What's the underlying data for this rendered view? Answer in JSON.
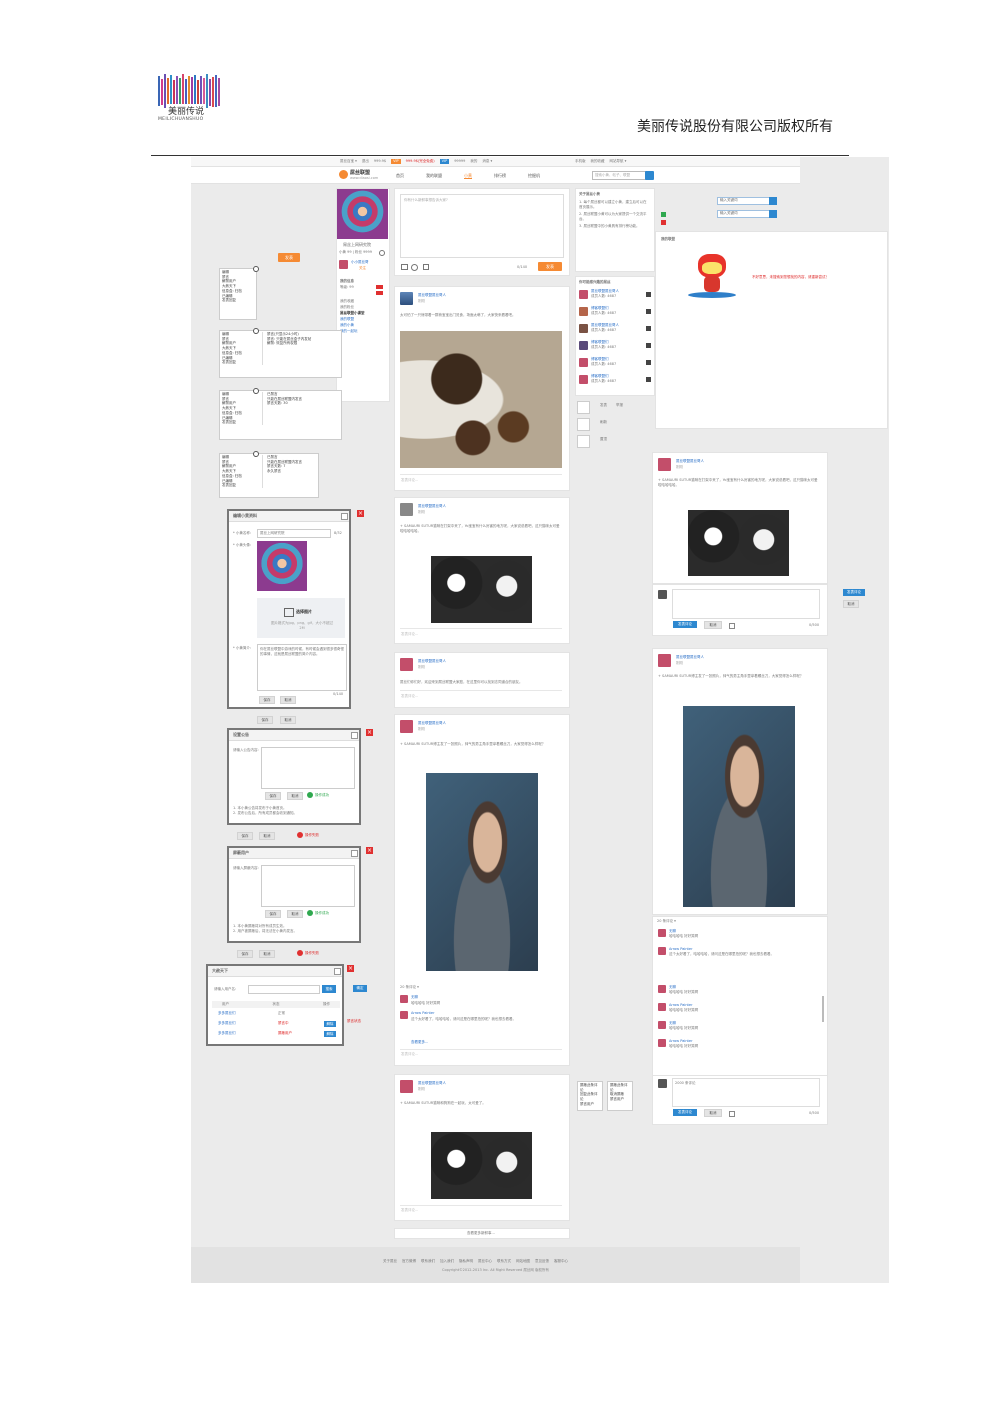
{
  "doc": {
    "logo_text": "美丽传说",
    "logo_sub": "MEILICHUANSHUO",
    "copyright_header": "美丽传说股份有限公司版权所有"
  },
  "topbar": {
    "items": [
      "屌丝百宝 ▾",
      "退出",
      "999.9$",
      "VIP",
      "999.9$(完全免费)",
      "VIP",
      "99999",
      "我的",
      "消息 ▾"
    ],
    "right": [
      "手机版",
      "我的收藏",
      "网站导航 ▾"
    ]
  },
  "nav": {
    "brand": "屌丝联盟",
    "brand_sub": "www.diaosi.com",
    "tabs": [
      "首页",
      "我的联盟",
      "小黄",
      "排行榜",
      "挖掘机"
    ],
    "search_placeholder": "搜索小黄、帖子、联盟",
    "search_icon": "search-icon"
  },
  "profile": {
    "name": "屌丝上网研究院",
    "stats": "小黄 99 | 粉丝 9999",
    "gear": "gear-icon",
    "user": "小小屌丝哥",
    "action": "关注",
    "publish": "发表",
    "level": "等级: 99",
    "menu_title": "我的信息",
    "menu_items": [
      "我的收藏",
      "我的粉丝",
      "屌丝联盟小课堂",
      "我的联盟",
      "我的小黄",
      "我的一起玩"
    ]
  },
  "popup_menus": [
    {
      "items": [
        "编辑",
        "禁言",
        "解禁用户",
        "大赦天下",
        "信息盒: 归档",
        "已编辑",
        "发表回复"
      ]
    },
    {
      "items": [
        "编辑",
        "禁言",
        "解禁用户",
        "大赦天下",
        "信息盒: 归档",
        "已编辑",
        "发表回复"
      ],
      "right_title": "禁言(只显示24小时)",
      "right_items": [
        "禁言: 只能在屌丝盒子内发帖",
        "解禁: 恢复所有权限"
      ]
    },
    {
      "items": [
        "编辑",
        "禁言",
        "解禁用户",
        "大赦天下",
        "信息盒: 归档",
        "已编辑",
        "发表回复"
      ],
      "right_title": "已禁言",
      "right_items": [
        "只能在屌丝联盟内发言",
        "禁言天数: 30"
      ]
    },
    {
      "items": [
        "编辑",
        "禁言",
        "解禁用户",
        "大赦天下",
        "信息盒: 归档",
        "已编辑",
        "发表回复"
      ],
      "right_title": "已禁言",
      "right_items": [
        "只能在屌丝联盟内发言",
        "禁言天数: 7",
        "永久禁言"
      ]
    }
  ],
  "dialogs": {
    "edit_profile": {
      "title": "编辑小黄资料",
      "name_label": "* 小黄名称:",
      "name_value": "屌丝上网研究院",
      "count": "8/32",
      "avatar_label": "* 小黄头像:",
      "upload_btn": "选择图片",
      "upload_hint": "图片格式为jpg、png、gif，大小不超过2M",
      "intro_label": "* 小黄简介:",
      "intro_text": "你在屌丝联盟中游戏的时候，有时候会遇到很多很奇怪的事情，这就是屌丝联盟的简介内容。",
      "intro_count": "0/140",
      "save": "保存",
      "cancel": "取消",
      "outer_save": "保存",
      "outer_cancel": "取消"
    },
    "announce": {
      "title": "设置公告",
      "label": "请输入公告内容:",
      "save": "保存",
      "cancel": "取消",
      "ok_text": "操作成功",
      "notes": [
        "1. 本小黄公告将发布于小黄首页。",
        "2. 发布公告后，所有成员都会收到通知。"
      ],
      "outer_save": "保存",
      "outer_cancel": "取消",
      "fail_text": "操作失败"
    },
    "ban": {
      "title": "屏蔽用户",
      "label": "请输入屏蔽内容:",
      "save": "保存",
      "cancel": "取消",
      "ok_text": "操作成功",
      "notes": [
        "1. 本小黄屏蔽将对所有成员生效。",
        "2. 用户被屏蔽后，将无法在小黄内发言。"
      ],
      "outer_save": "保存",
      "outer_cancel": "取消",
      "fail_text": "操作失败"
    },
    "amnesty": {
      "title": "大赦天下",
      "label": "请输入用户名:",
      "search": "搜索",
      "cols": [
        "用户",
        "状态",
        "操作"
      ],
      "rows": [
        {
          "user": "多多屌丝们",
          "status": "正常",
          "op": ""
        },
        {
          "user": "多多屌丝们",
          "status": "禁言中",
          "op": "解除"
        },
        {
          "user": "多多屌丝们",
          "status": "屏蔽用户",
          "op": "解除"
        }
      ],
      "side_btn": "确定",
      "side_note": "禁言状态"
    }
  },
  "composer": {
    "placeholder": "你有什么新鲜事想告诉大家?",
    "count": "0/140",
    "publish": "发表"
  },
  "posts": [
    {
      "author": "屌丝联盟屌丝哥人",
      "time": "刚刚",
      "text": "太可怕了一只熊带着一群熊宝宝出门觅食，场面太萌了，大家快来看看吧。",
      "input_hint": "发表评论..."
    },
    {
      "author": "屌丝联盟屌丝哥人",
      "time": "刚刚",
      "text": "+ SAMAURI SUTUR猫咪在打架中来了，Yo宝宝有什么厉害的地方呢，大家说说看吧，这只猫咪太可爱啦哈哈哈哈。",
      "input_hint": "发表评论..."
    },
    {
      "author": "屌丝联盟屌丝哥人",
      "time": "刚刚",
      "text": "屌丝们你们好，欢迎来到屌丝联盟大家庭，在这里你可以找到志同道合的朋友。",
      "input_hint": "发表评论..."
    },
    {
      "author": "屌丝联盟屌丝哥人",
      "time": "刚刚",
      "text": "+ SAMAURI SUTUR博主发了一张照片，帅气的男主角手里拿着螺丝刀，大家觉得怎么样呢？",
      "input_hint": "发表评论..."
    },
    {
      "author": "屌丝联盟屌丝哥人",
      "time": "刚刚",
      "text": "+ SAMAURI SUTUR猫咪和狗狗在一起玩，太可爱了。",
      "input_hint": "发表评论..."
    }
  ],
  "comments": {
    "header": "20 条评论 ▾",
    "items": [
      {
        "user": "无聊",
        "text": "哈哈哈哈 好好笑啊"
      },
      {
        "user": "Arrow Painter",
        "text": "这个太好看了，哈哈哈哈，请问这是在哪里拍的呢？我也想去看看。"
      }
    ],
    "reply_hint": "发表评论...",
    "more": "查看更多..."
  },
  "side_panel": {
    "tips_title": "关于屌丝小黄",
    "tips": [
      "1. 每个屌丝都可以建立小黄，建立后可以在首页展示。",
      "2. 屌丝联盟小黄可以为大家提供一个交流平台。",
      "3. 屌丝联盟中的小黄具有排行榜功能。"
    ],
    "members_title": "你可能感兴趣的屌丝",
    "members": [
      {
        "name": "屌丝联盟屌丝哥人",
        "meta": "成员人数: 4687"
      },
      {
        "name": "博客联盟们",
        "meta": "成员人数: 4687"
      },
      {
        "name": "屌丝联盟屌丝哥人",
        "meta": "成员人数: 4687"
      },
      {
        "name": "博客联盟们",
        "meta": "成员人数: 4687"
      },
      {
        "name": "博客联盟们",
        "meta": "成员人数: 4687"
      },
      {
        "name": "博客联盟们",
        "meta": "成员人数: 4687"
      }
    ],
    "tool_labels": [
      "发表",
      "刷新",
      "置顶",
      "举报"
    ]
  },
  "right_area": {
    "search1": "输入关键词",
    "search2": "输入关键词",
    "empty_title": "我的联盟",
    "empty_text": "不好意思，未搜索到您想找的内容，请重新尝试！",
    "comment_box": {
      "submit": "发表评论",
      "cancel": "取消",
      "count": "0/500"
    },
    "side_btns": [
      "发表评论",
      "取消"
    ],
    "bottom_comment_box": {
      "placeholder": "2000 条评论",
      "submit": "发表评论",
      "cancel": "取消",
      "count": "0/500"
    }
  },
  "context_menus": [
    {
      "items": [
        "屏蔽此条评论",
        "回复此条评论",
        "禁言用户"
      ]
    },
    {
      "items": [
        "屏蔽此条评论",
        "取消屏蔽",
        "禁言用户"
      ]
    }
  ],
  "load_more": "查看更多新鲜事...",
  "footer": {
    "links": [
      "关于屌丝",
      "官方微博",
      "联系我们",
      "加入我们",
      "隐私声明",
      "屌丝中心",
      "联系方式",
      "网站地图",
      "意见反馈",
      "客服中心"
    ],
    "copy": "Copyright©2012-2013 Inc. All Right Reserved 屌丝网 版权所有"
  },
  "colors": {
    "accent": "#f58a33",
    "link": "#2a6fc7",
    "danger": "#e03030",
    "ok": "#2fa84f",
    "canvas": "#ebebeb"
  }
}
